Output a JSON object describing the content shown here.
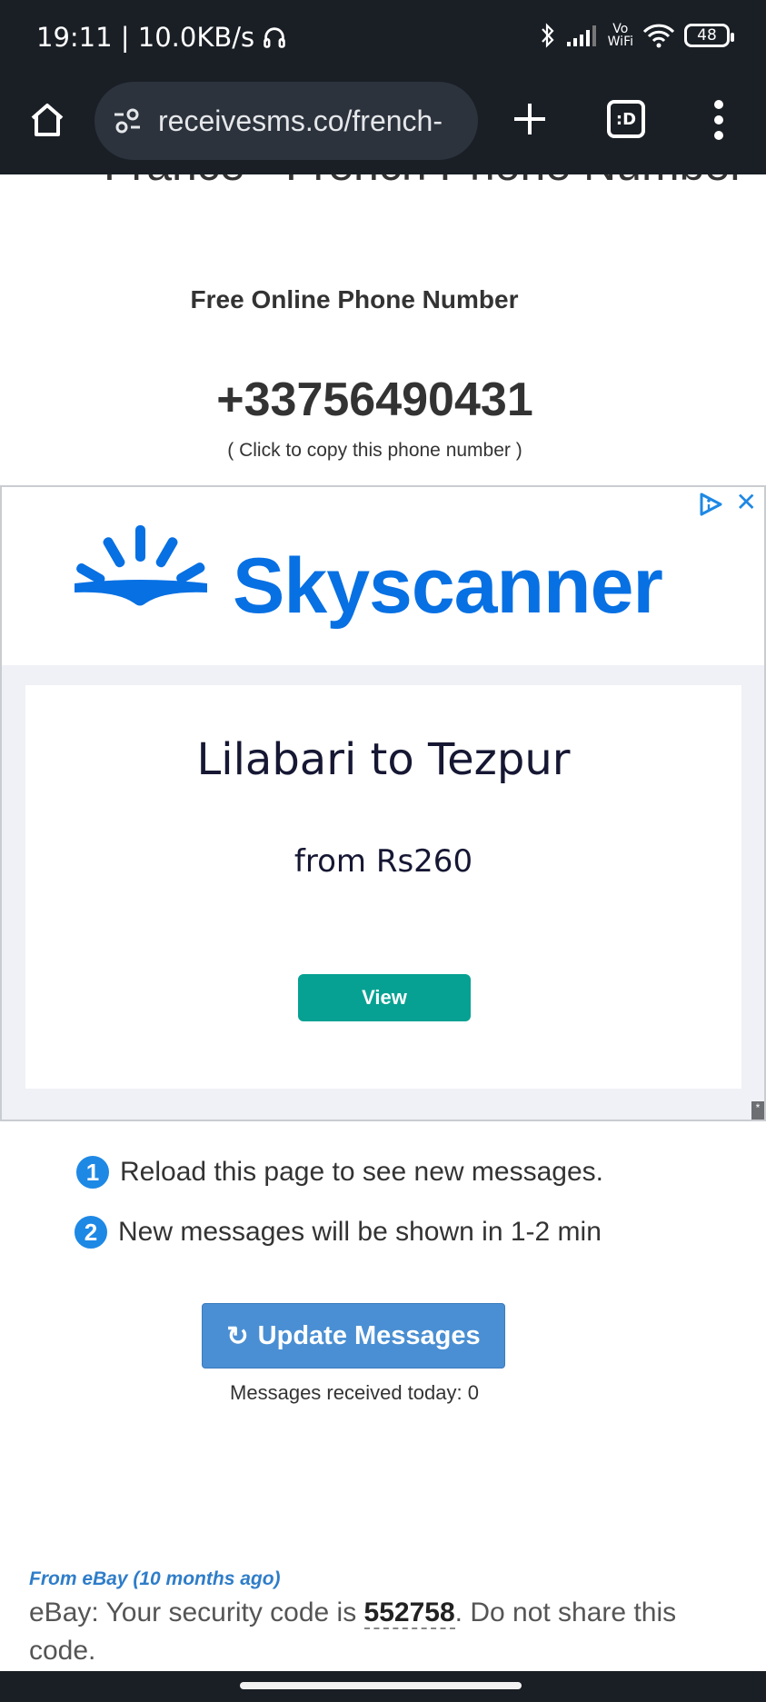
{
  "status_bar": {
    "time_speed": "19:11 | 10.0KB/s",
    "wifi_label_top": "Vo",
    "wifi_label_bottom": "WiFi",
    "battery": "48"
  },
  "browser": {
    "url": "receivesms.co/french-",
    "tab_label": ":D"
  },
  "page": {
    "heading": "France - French Phone Number",
    "subtitle": "Free Online Phone Number",
    "phone_number": "+33756490431",
    "copy_hint": "( Click to copy this phone number )"
  },
  "ad": {
    "brand": "Skyscanner",
    "route": "Lilabari to Tezpur",
    "price": "from Rs260",
    "button_label": "View",
    "close_glyph": "✕",
    "corner_glyph": "*",
    "brand_color": "#0770e3",
    "button_color": "#06a192"
  },
  "steps": [
    {
      "number": "1",
      "text": "Reload this page to see new messages."
    },
    {
      "number": "2",
      "text": "New messages will be shown in 1-2 min"
    }
  ],
  "update": {
    "icon_glyph": "↻",
    "label": "Update Messages",
    "received_today": "Messages received today: 0"
  },
  "messages": [
    {
      "from": "From eBay (10 months ago)",
      "prefix": "eBay: Your security code is ",
      "code": "552758",
      "suffix": ". Do not share this code."
    }
  ],
  "colors": {
    "system_bar": "#1a1f26",
    "accent_blue": "#1e88e5",
    "update_button": "#4a8fd3"
  }
}
